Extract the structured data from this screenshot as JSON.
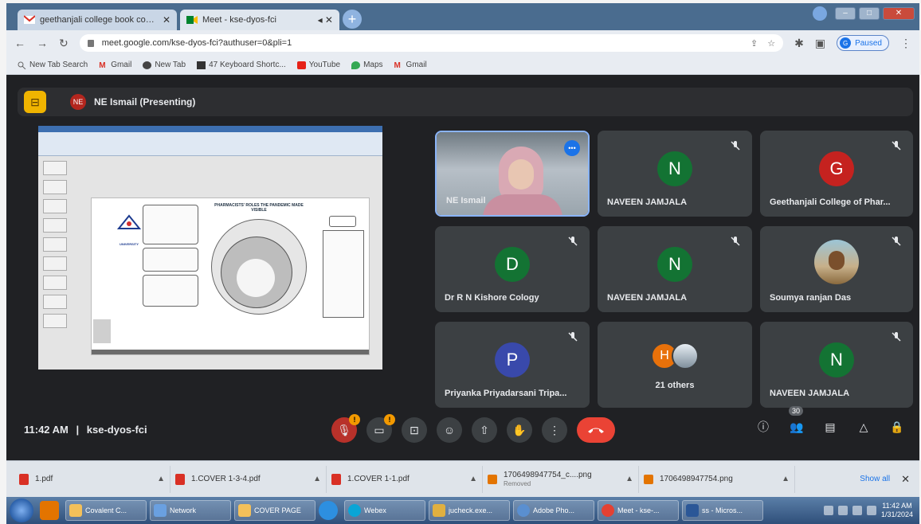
{
  "browser": {
    "tabs": [
      {
        "label": "geethanjali college book cover p",
        "active": false
      },
      {
        "label": "Meet - kse-dyos-fci",
        "active": true
      }
    ],
    "url": "meet.google.com/kse-dyos-fci?authuser=0&pli=1",
    "profile_status": "Paused",
    "profile_initial": "G",
    "bookmarks": [
      {
        "label": "New Tab Search",
        "icon": "search-icon"
      },
      {
        "label": "Gmail",
        "icon": "gmail-icon"
      },
      {
        "label": "New Tab",
        "icon": "chrome-icon"
      },
      {
        "label": "47 Keyboard Shortc...",
        "icon": "bookmark-icon"
      },
      {
        "label": "YouTube",
        "icon": "youtube-icon"
      },
      {
        "label": "Maps",
        "icon": "maps-icon"
      },
      {
        "label": "Gmail",
        "icon": "gmail-icon"
      }
    ]
  },
  "meet": {
    "presenter_avatar": "NE",
    "presenter_label": "NE Ismail (Presenting)",
    "slide_title": "PHARMACISTS' ROLES THE PANDEMIC MADE VISIBLE",
    "slide_logo": "UNIVERSITY",
    "participants": [
      {
        "name": "NE Ismail",
        "type": "video",
        "muted": false
      },
      {
        "name": "NAVEEN JAMJALA",
        "initial": "N",
        "color": "#137333",
        "muted": true
      },
      {
        "name": "Geethanjali College of Phar...",
        "initial": "G",
        "color": "#c5221f",
        "muted": true
      },
      {
        "name": "Dr R N Kishore Cology",
        "initial": "D",
        "color": "#137333",
        "muted": true
      },
      {
        "name": "NAVEEN JAMJALA",
        "initial": "N",
        "color": "#137333",
        "muted": true
      },
      {
        "name": "Soumya ranjan Das",
        "type": "photo",
        "muted": true
      },
      {
        "name": "Priyanka Priyadarsani Tripa...",
        "initial": "P",
        "color": "#3949ab",
        "muted": true
      },
      {
        "name": "21 others",
        "type": "others",
        "initial": "H",
        "muted": false
      },
      {
        "name": "NAVEEN JAMJALA",
        "initial": "N",
        "color": "#137333",
        "muted": true
      }
    ],
    "time": "11:42 AM",
    "meeting_code": "kse-dyos-fci",
    "people_count": "30",
    "colors": {
      "bg": "#202124",
      "tile": "#3c4043",
      "hangup": "#ea4335",
      "accent": "#8ab4f8"
    }
  },
  "downloads": {
    "items": [
      {
        "name": "1.pdf",
        "type": "pdf",
        "status": ""
      },
      {
        "name": "1.COVER 1-3-4.pdf",
        "type": "pdf",
        "status": ""
      },
      {
        "name": "1.COVER 1-1.pdf",
        "type": "pdf",
        "status": ""
      },
      {
        "name": "1706498947754_c....png",
        "type": "png",
        "status": "Removed"
      },
      {
        "name": "1706498947754.png",
        "type": "png",
        "status": ""
      }
    ],
    "show_all": "Show all"
  },
  "taskbar": {
    "items": [
      "Covalent C...",
      "Network",
      "COVER PAGE",
      "Webex",
      "jucheck.exe...",
      "Adobe Pho...",
      "Meet - kse-...",
      "ss - Micros..."
    ],
    "time": "11:42 AM",
    "date": "1/31/2024"
  }
}
